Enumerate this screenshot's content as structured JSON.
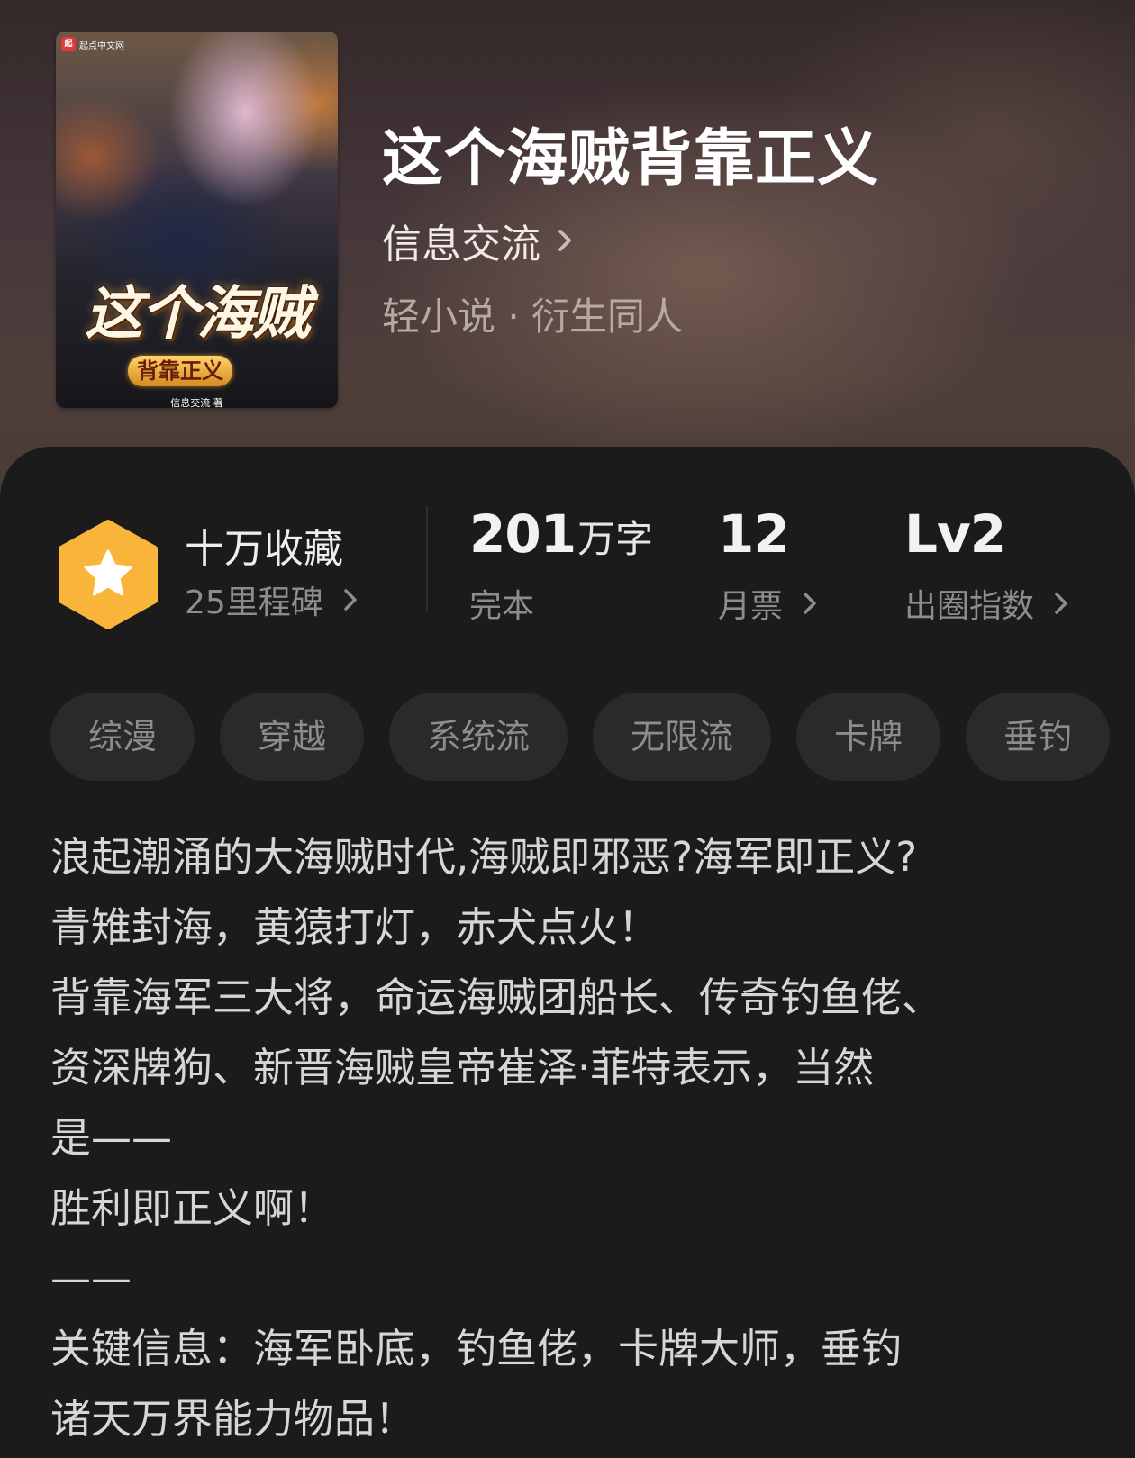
{
  "book": {
    "title": "这个海贼背靠正义",
    "author": "信息交流",
    "category": "轻小说 · 衍生同人",
    "cover": {
      "badge": "起点中文网",
      "badge_mark": "起",
      "title_main": "这个海贼",
      "title_sub": "背靠正义",
      "author": "信息交流 著"
    }
  },
  "stats": {
    "collection": "十万收藏",
    "milestone": "25里程碑",
    "word_count_value": "201",
    "word_count_unit": "万字",
    "status": "完本",
    "monthly_votes_value": "12",
    "monthly_votes_label": "月票",
    "level_value": "Lv2",
    "level_label": "出圈指数"
  },
  "tags": [
    "综漫",
    "穿越",
    "系统流",
    "无限流",
    "卡牌",
    "垂钓"
  ],
  "synopsis": {
    "lines": [
      "浪起潮涌的大海贼时代,海贼即邪恶?海军即正义?",
      "青雉封海，黄猿打灯，赤犬点火！",
      "背靠海军三大将，命运海贼团船长、传奇钓鱼佬、",
      "资深牌狗、新晋海贼皇帝崔泽·菲特表示，当然",
      "是——",
      "胜利即正义啊！",
      "——",
      "关键信息：海军卧底，钓鱼佬，卡牌大师，垂钓",
      "诸天万界能力物品！"
    ]
  },
  "colors": {
    "badge_gold": "#f9b43a",
    "panel_bg": "#1b1b1c",
    "tag_bg": "#2a2a2c"
  }
}
